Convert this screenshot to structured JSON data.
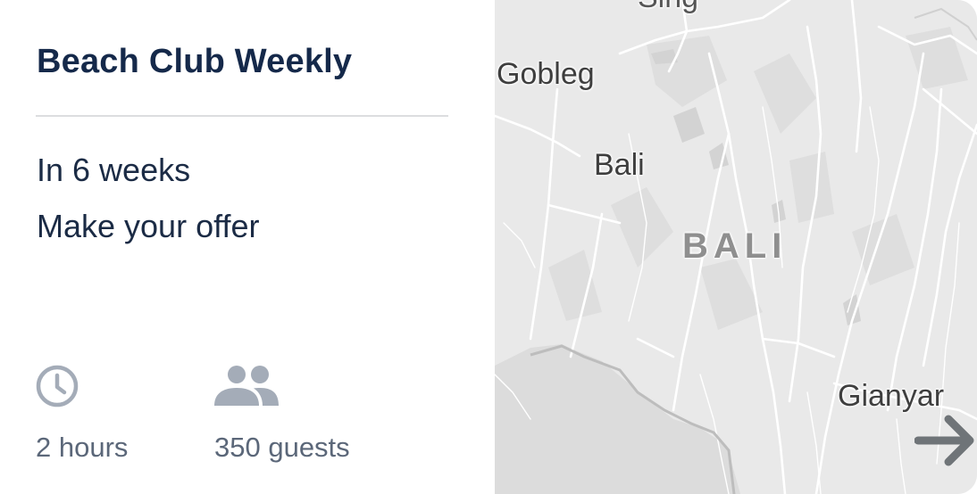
{
  "event": {
    "title": "Beach Club Weekly",
    "timing": "In 6 weeks",
    "offer_prompt": "Make your offer",
    "duration": {
      "icon": "clock-icon",
      "label": "2 hours"
    },
    "guests": {
      "icon": "guests-icon",
      "label": "350 guests"
    }
  },
  "map": {
    "labels": {
      "top_cut": "Sing",
      "gobleg": "Gobleg",
      "bali_town": "Bali",
      "bali_region": "BALI",
      "gianyar": "Gianyar"
    },
    "next_icon": "arrow-right-icon"
  },
  "colors": {
    "title": "#15294a",
    "body_text": "#1b2b45",
    "meta_text": "#5b6779",
    "icon": "#a4acb8",
    "map_bg": "#e8e8e8",
    "arrow": "#6f7478"
  }
}
